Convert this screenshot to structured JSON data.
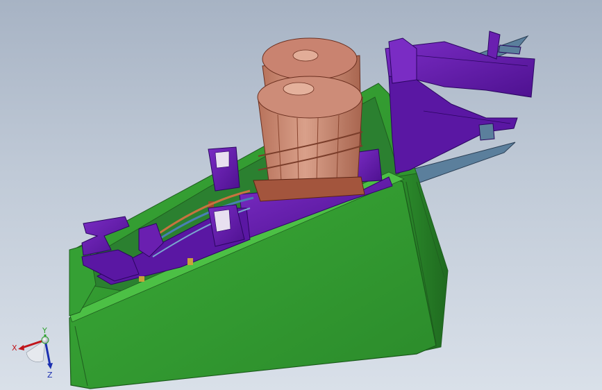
{
  "viewport": {
    "background_top": "#a7b3c4",
    "background_bottom": "#d9e0e9"
  },
  "model": {
    "colors": {
      "housing": "#2f9a2f",
      "housing_dark": "#1f6e1f",
      "housing_light": "#3fb63a",
      "brackets": "#6a1fb0",
      "brackets_dark": "#3d0a6e",
      "cups": "#c98a72",
      "cups_dark": "#7a3d2a",
      "plate": "#5b7f9c"
    }
  },
  "triad": {
    "x_label": "X",
    "y_label": "Y",
    "z_label": "Z",
    "x_color": "#c0151b",
    "y_color": "#2ea12e",
    "z_color": "#1b2fb0"
  }
}
